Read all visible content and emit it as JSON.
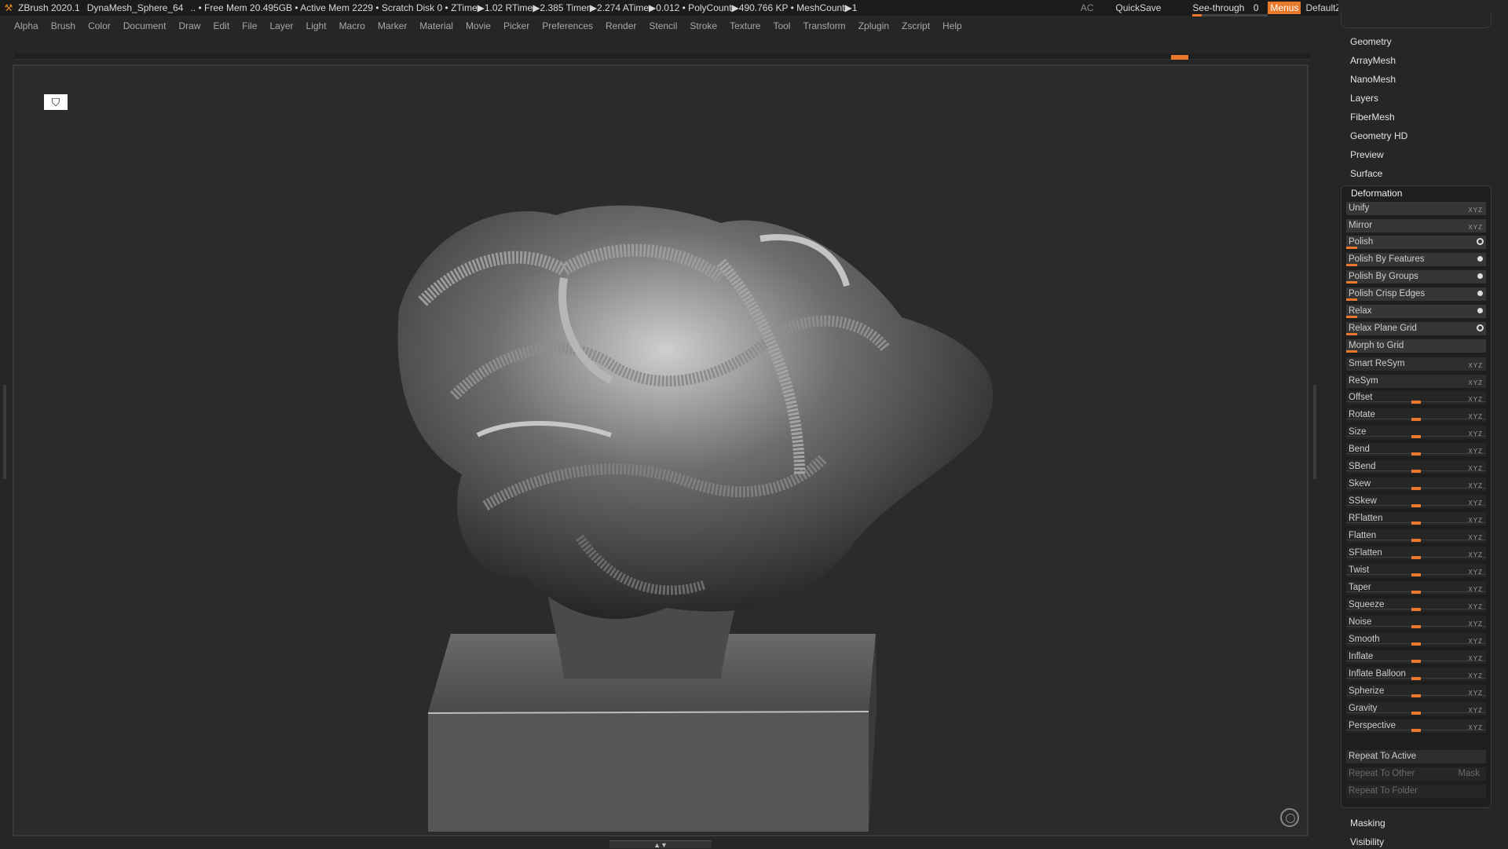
{
  "topbar": {
    "app": "ZBrush 2020.1",
    "doc": "DynaMesh_Sphere_64",
    "stats": ".. • Free Mem 20.495GB • Active Mem 2229 • Scratch Disk 0 •  ZTime▶1.02 RTime▶2.385 Timer▶2.274 ATime▶0.012 • PolyCount▶490.766 KP  • MeshCount▶1",
    "ac": "AC",
    "quicksave": "QuickSave",
    "see_through_label": "See-through",
    "see_through_value": "0",
    "menus": "Menus",
    "zscript": "DefaultZScript",
    "accent": "#e8782a"
  },
  "menubar": [
    "Alpha",
    "Brush",
    "Color",
    "Document",
    "Draw",
    "Edit",
    "File",
    "Layer",
    "Light",
    "Macro",
    "Marker",
    "Material",
    "Movie",
    "Picker",
    "Preferences",
    "Render",
    "Stencil",
    "Stroke",
    "Texture",
    "Tool",
    "Transform",
    "Zplugin",
    "Zscript",
    "Help"
  ],
  "right_panel": {
    "subpalettes_top": [
      "Geometry",
      "ArrayMesh",
      "NanoMesh",
      "Layers",
      "FiberMesh",
      "Geometry HD",
      "Preview",
      "Surface"
    ],
    "deformation": {
      "title": "Deformation",
      "buttons": [
        {
          "label": "Unify",
          "type": "button",
          "icons": "xyz"
        },
        {
          "label": "Mirror",
          "type": "button",
          "icons": "xyz"
        }
      ],
      "polish_rows": [
        {
          "label": "Polish",
          "indicator": "ring"
        },
        {
          "label": "Polish By Features",
          "indicator": "dot"
        },
        {
          "label": "Polish By Groups",
          "indicator": "dot"
        },
        {
          "label": "Polish Crisp Edges",
          "indicator": "dot"
        },
        {
          "label": "Relax",
          "indicator": "dot"
        },
        {
          "label": "Relax Plane Grid",
          "indicator": "ring"
        },
        {
          "label": "Morph to Grid",
          "indicator": "none"
        }
      ],
      "sym_buttons": [
        {
          "label": "Smart ReSym"
        },
        {
          "label": "ReSym"
        }
      ],
      "sliders": [
        "Offset",
        "Rotate",
        "Size",
        "Bend",
        "SBend",
        "Skew",
        "SSkew",
        "RFlatten",
        "Flatten",
        "SFlatten",
        "Twist",
        "Taper",
        "Squeeze",
        "Noise",
        "Smooth",
        "Inflate",
        "Inflate Balloon",
        "Spherize",
        "Gravity",
        "Perspective"
      ],
      "repeat_to_active": "Repeat To Active",
      "repeat_to_other": "Repeat To Other",
      "mask": "Mask",
      "repeat_to_folder": "Repeat To Folder"
    },
    "subpalettes_bottom": [
      "Masking",
      "Visibility"
    ]
  }
}
